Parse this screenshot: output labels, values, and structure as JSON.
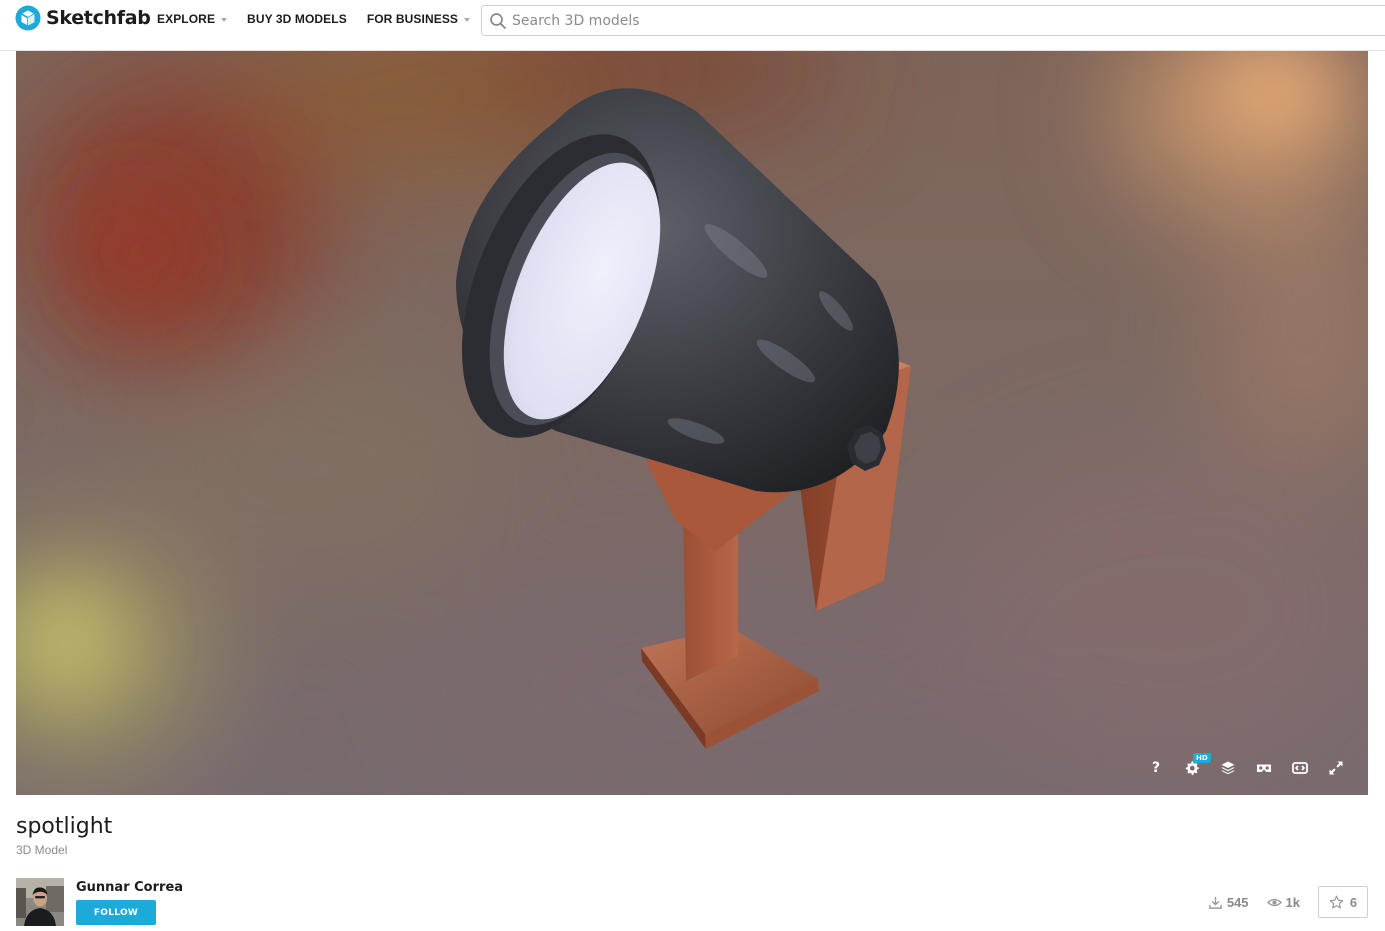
{
  "header": {
    "brand": "Sketchfab",
    "nav": [
      {
        "label": "EXPLORE",
        "has_caret": true
      },
      {
        "label": "BUY 3D MODELS",
        "has_caret": false
      },
      {
        "label": "FOR BUSINESS",
        "has_caret": true
      }
    ],
    "search_placeholder": "Search 3D models"
  },
  "viewer": {
    "controls": [
      {
        "icon": "help-icon",
        "label": "?"
      },
      {
        "icon": "settings-icon",
        "badge": "HD"
      },
      {
        "icon": "layers-icon"
      },
      {
        "icon": "vr-icon"
      },
      {
        "icon": "embed-icon"
      },
      {
        "icon": "fullscreen-icon"
      }
    ]
  },
  "model": {
    "title": "spotlight",
    "type_label": "3D Model",
    "author": "Gunnar Correa",
    "follow_label": "FOLLOW",
    "downloads": "545",
    "views": "1k",
    "likes": "6"
  },
  "colors": {
    "accent": "#1caad9",
    "text": "#1c1c1c",
    "muted": "#8a8a8a"
  }
}
